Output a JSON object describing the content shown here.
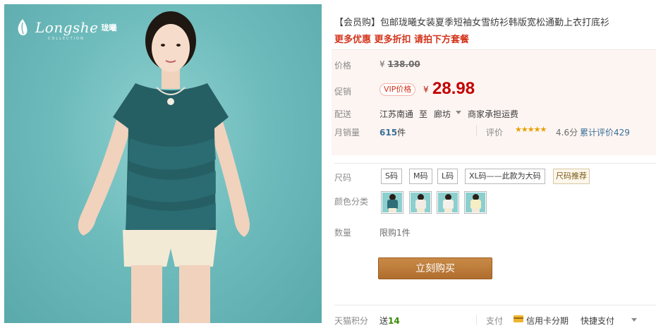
{
  "product_image": {
    "brand_name": "Longshe",
    "brand_cn": "珑曦",
    "brand_sub": "COLLECTION"
  },
  "product": {
    "title": "【会员购】包邮珑曦女装夏季短袖女雪纺衫韩版宽松通勤上衣打底衫",
    "promo": "更多优惠 更多折扣 请拍下方套餐"
  },
  "price": {
    "label": "价格",
    "original": "138.00",
    "currency": "¥"
  },
  "sale": {
    "label": "促销",
    "vip_tag": "VIP价格",
    "currency": "¥",
    "price": "28.98"
  },
  "shipping": {
    "label": "配送",
    "from": "江苏南通",
    "to_word": "至",
    "destination": "廊坊",
    "fee": "商家承担运费"
  },
  "sales": {
    "label": "月销量",
    "count": "615",
    "unit": "件",
    "rating_label": "评价",
    "stars": "★★★★★",
    "score": "4.6分",
    "review_link": "累计评价429"
  },
  "size": {
    "label": "尺码",
    "options": [
      "S码",
      "M码",
      "L码",
      "XL码——此款为大码"
    ],
    "guide": "尺码推荐"
  },
  "color": {
    "label": "颜色分类",
    "swatch_colors": [
      "#2f6f78",
      "#f2ece4",
      "#f4f1ea",
      "#f6eec2"
    ]
  },
  "quantity": {
    "label": "数量",
    "limit": "限购1件"
  },
  "buy_button": "立刻购买",
  "footer": {
    "points_label": "天猫积分",
    "points_prefix": "送",
    "points_value": "14",
    "pay_label": "支付",
    "pay_card": "信用卡分期",
    "pay_quick": "快捷支付"
  },
  "colors": {
    "sale_price": "#c40000",
    "promo": "#d4341c",
    "link": "#3c6f96",
    "buy_button": "#b5722f",
    "background": "#6fbcbd"
  }
}
